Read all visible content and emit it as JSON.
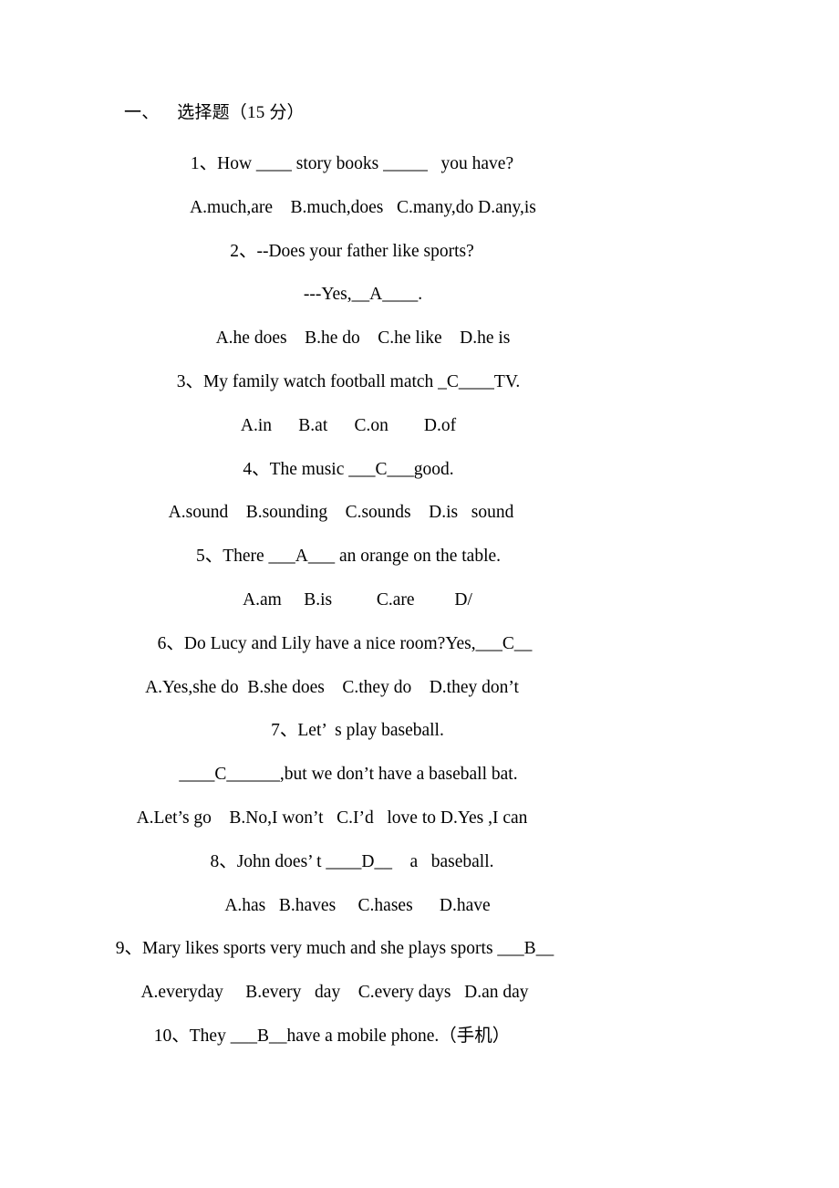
{
  "document": {
    "section_heading": "一、    选择题（15 分）",
    "lines": [
      {
        "kind": "question",
        "text": "1、How ____ story books _____   you have?",
        "offset": "nudge-r16"
      },
      {
        "kind": "options",
        "text": "A.much,are    B.much,does   C.many,do D.any,is",
        "offset": "nudge-r28"
      },
      {
        "kind": "question",
        "text": "2、--Does your father like sports?",
        "offset": "nudge-r16"
      },
      {
        "kind": "question",
        "text": "---Yes,__A____.",
        "offset": "nudge-r28"
      },
      {
        "kind": "options",
        "text": "A.he does    B.he do    C.he like    D.he is",
        "offset": "nudge-r28"
      },
      {
        "kind": "question",
        "text": "3、My family watch football match _C____TV.",
        "offset": "nudge-r12"
      },
      {
        "kind": "options",
        "text": "A.in      B.at      C.on        D.of",
        "offset": "nudge-r12"
      },
      {
        "kind": "question",
        "text": "4、The music ___C___good.",
        "offset": "nudge-r12"
      },
      {
        "kind": "options",
        "text": "A.sound    B.sounding    C.sounds    D.is   sound",
        "offset": "nudge-r4"
      },
      {
        "kind": "question",
        "text": "5、There ___A___ an orange on the table.",
        "offset": "nudge-r12"
      },
      {
        "kind": "options",
        "text": "A.am     B.is          C.are         D/",
        "offset": "nudge-r22"
      },
      {
        "kind": "question",
        "text": "6、Do Lucy and Lily have a nice room?Yes,___C__",
        "offset": "nudge-r8"
      },
      {
        "kind": "options",
        "text": "A.Yes,she do  B.she does    C.they do    D.they don’t",
        "offset": "nudge-l6"
      },
      {
        "kind": "question",
        "text": "7、Let’  s play baseball.",
        "offset": "nudge-r22"
      },
      {
        "kind": "question",
        "text": "____C______,but we don’t have a baseball bat.",
        "offset": "nudge-r12"
      },
      {
        "kind": "options",
        "text": "A.Let’s go    B.No,I won’t   C.I’d   love to D.Yes ,I can",
        "offset": "nudge-l6"
      },
      {
        "kind": "question",
        "text": "8、John does’ t ____D__    a   baseball.",
        "offset": "nudge-r16"
      },
      {
        "kind": "options",
        "text": "A.has   B.haves     C.hases      D.have",
        "offset": "nudge-r22"
      },
      {
        "kind": "question",
        "text": "9、Mary likes sports very much and she plays sports ___B__",
        "offset": "nudge-l3"
      },
      {
        "kind": "options",
        "text": "A.everyday     B.every   day    C.every days   D.an day",
        "offset": "nudge-l3"
      },
      {
        "kind": "question",
        "text": "10、They ___B__have a mobile phone.（手机）",
        "offset": "nudge-l6"
      }
    ]
  },
  "style": {
    "text_color": "#000000",
    "background_color": "#ffffff"
  }
}
